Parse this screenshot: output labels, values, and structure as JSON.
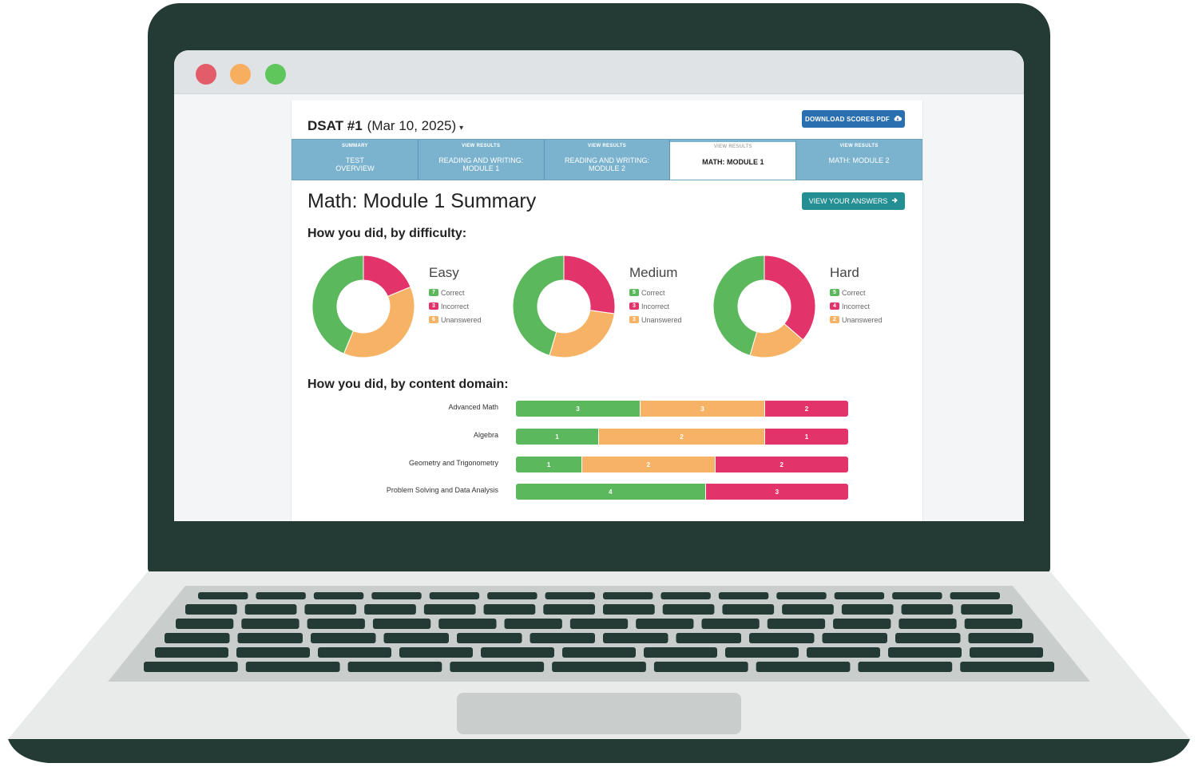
{
  "window": {
    "dots": [
      "#e25c6a",
      "#f7ae5f",
      "#5ec65a"
    ]
  },
  "header": {
    "test_name": "DSAT #1",
    "test_date": "(Mar 10, 2025)",
    "caret": "▾",
    "download_label": "DOWNLOAD SCORES PDF",
    "download_icon": "cloud-download-icon"
  },
  "tabs": [
    {
      "small": "SUMMARY",
      "label1": "TEST",
      "label2": "OVERVIEW",
      "active": false
    },
    {
      "small": "VIEW RESULTS",
      "label1": "READING AND WRITING:",
      "label2": "MODULE 1",
      "active": false
    },
    {
      "small": "VIEW RESULTS",
      "label1": "READING AND WRITING:",
      "label2": "MODULE 2",
      "active": false
    },
    {
      "small": "VIEW RESULTS",
      "label1": "MATH: MODULE 1",
      "label2": "",
      "active": true
    },
    {
      "small": "VIEW RESULTS",
      "label1": "MATH: MODULE 2",
      "label2": "",
      "active": false
    }
  ],
  "summary": {
    "title": "Math: Module 1 Summary",
    "answers_label": "VIEW YOUR ANSWERS",
    "answers_icon": "arrow-right-icon",
    "difficulty_heading": "How you did, by difficulty:",
    "domain_heading": "How you did, by content domain:"
  },
  "legend_labels": {
    "correct": "Correct",
    "incorrect": "Incorrect",
    "unanswered": "Unanswered"
  },
  "colors": {
    "correct": "#5cb85c",
    "incorrect": "#e2336b",
    "unanswered": "#f7b365"
  },
  "chart_data": [
    {
      "type": "pie",
      "title": "Easy",
      "categories": [
        "Correct",
        "Incorrect",
        "Unanswered"
      ],
      "values": [
        7,
        3,
        6
      ]
    },
    {
      "type": "pie",
      "title": "Medium",
      "categories": [
        "Correct",
        "Incorrect",
        "Unanswered"
      ],
      "values": [
        5,
        3,
        3
      ]
    },
    {
      "type": "pie",
      "title": "Hard",
      "categories": [
        "Correct",
        "Incorrect",
        "Unanswered"
      ],
      "values": [
        5,
        4,
        2
      ]
    },
    {
      "type": "bar",
      "categories": [
        "Advanced Math",
        "Algebra",
        "Geometry and Trigonometry",
        "Problem Solving and Data Analysis"
      ],
      "series": [
        {
          "name": "Correct",
          "values": [
            3,
            1,
            1,
            4
          ]
        },
        {
          "name": "Unanswered",
          "values": [
            3,
            2,
            2,
            0
          ]
        },
        {
          "name": "Incorrect",
          "values": [
            2,
            1,
            2,
            3
          ]
        }
      ]
    }
  ]
}
